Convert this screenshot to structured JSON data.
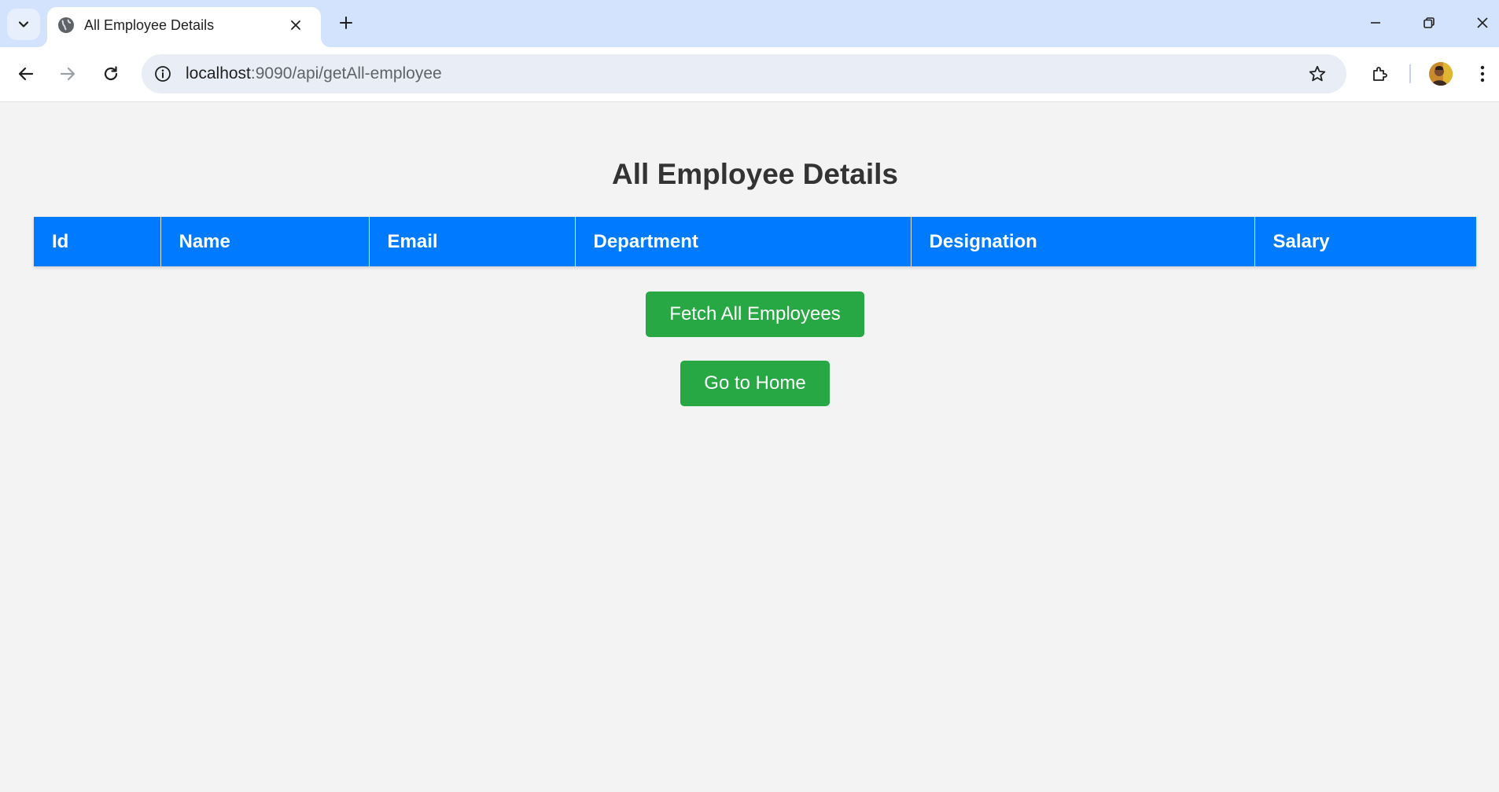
{
  "browser": {
    "tab": {
      "title": "All Employee Details"
    },
    "address_bar": {
      "host": "localhost",
      "path": ":9090/api/getAll-employee"
    }
  },
  "page": {
    "title": "All Employee Details",
    "table": {
      "columns": [
        "Id",
        "Name",
        "Email",
        "Department",
        "Designation",
        "Salary"
      ],
      "rows": []
    },
    "buttons": {
      "fetch": "Fetch All Employees",
      "home": "Go to Home"
    }
  },
  "colors": {
    "header_bg": "#007bff",
    "button_bg": "#28a745",
    "page_bg": "#f3f3f3",
    "tabstrip_bg": "#d3e3fd"
  },
  "icons": [
    "tab-search-icon",
    "globe-icon",
    "close-icon",
    "plus-icon",
    "minimize-icon",
    "restore-icon",
    "window-close-icon",
    "back-arrow-icon",
    "forward-arrow-icon",
    "reload-icon",
    "info-icon",
    "star-icon",
    "extensions-icon",
    "kebab-menu-icon"
  ]
}
